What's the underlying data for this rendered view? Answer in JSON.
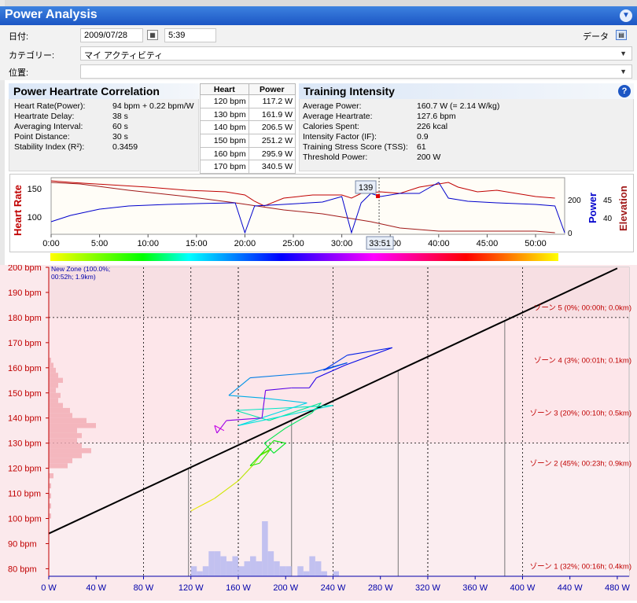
{
  "header": {
    "title": "Power Analysis"
  },
  "form": {
    "date_label": "日付:",
    "date_value": "2009/07/28",
    "time_value": "5:39",
    "data_label": "データ",
    "category_label": "カテゴリー:",
    "category_value": "マイ アクティビティ",
    "location_label": "位置:",
    "location_value": ""
  },
  "correlation": {
    "title": "Power Heartrate Correlation",
    "rows": [
      {
        "label": "Heart Rate(Power):",
        "value": "94 bpm + 0.22 bpm/W"
      },
      {
        "label": "Heartrate Delay:",
        "value": "38 s"
      },
      {
        "label": "Averaging Interval:",
        "value": "60 s"
      },
      {
        "label": "Point Distance:",
        "value": "30 s"
      },
      {
        "label": "Stability Index (R²):",
        "value": "0.3459"
      }
    ]
  },
  "hr_table": {
    "headers": [
      "Heart",
      "Power"
    ],
    "rows": [
      [
        "120 bpm",
        "117.2 W"
      ],
      [
        "130 bpm",
        "161.9 W"
      ],
      [
        "140 bpm",
        "206.5 W"
      ],
      [
        "150 bpm",
        "251.2 W"
      ],
      [
        "160 bpm",
        "295.9 W"
      ],
      [
        "170 bpm",
        "340.5 W"
      ]
    ]
  },
  "intensity": {
    "title": "Training Intensity",
    "rows": [
      {
        "label": "Average Power:",
        "value": "160.7 W (= 2.14 W/kg)"
      },
      {
        "label": "Average Heartrate:",
        "value": "127.6 bpm"
      },
      {
        "label": "Calories Spent:",
        "value": "226 kcal"
      },
      {
        "label": "Intensity Factor (IF):",
        "value": "0.9"
      },
      {
        "label": "Training Stress Score (TSS):",
        "value": "61"
      },
      {
        "label": "Threshold Power:",
        "value": "200 W"
      }
    ]
  },
  "timeline": {
    "left_axis_label": "Heart Rate",
    "right_axis1_label": "Power",
    "right_axis2_label": "Elevation",
    "hr_ticks": [
      "150",
      "100"
    ],
    "power_ticks": [
      "200",
      "0"
    ],
    "elev_ticks": [
      "45",
      "40"
    ],
    "time_ticks": [
      "0:00",
      "5:00",
      "10:00",
      "15:00",
      "20:00",
      "25:00",
      "30:00",
      "35:00",
      "40:00",
      "45:00",
      "50:00"
    ],
    "cursor_hr": "139",
    "cursor_time": "33:51"
  },
  "chart_data": {
    "type": "scatter",
    "title": "",
    "xlabel": "",
    "ylabel": "",
    "xlim": [
      0,
      490
    ],
    "ylim": [
      77,
      200
    ],
    "x_ticks": [
      "0 W",
      "40 W",
      "80 W",
      "120 W",
      "160 W",
      "200 W",
      "240 W",
      "280 W",
      "320 W",
      "360 W",
      "400 W",
      "440 W",
      "480 W"
    ],
    "y_ticks": [
      "200 bpm",
      "190 bpm",
      "180 bpm",
      "170 bpm",
      "160 bpm",
      "150 bpm",
      "140 bpm",
      "130 bpm",
      "120 bpm",
      "110 bpm",
      "100 bpm",
      "90 bpm",
      "80 bpm"
    ],
    "regression": {
      "intercept": 94,
      "slope": 0.22
    },
    "zone_lines_bpm": [
      180,
      130
    ],
    "zone_labels": [
      "ゾーン 5 (0%; 00:00h; 0.0km)",
      "ゾーン 4 (3%; 00:01h; 0.1km)",
      "ゾーン 3 (20%; 00:10h; 0.5km)",
      "ゾーン 2 (45%; 00:23h; 0.9km)",
      "ゾーン 1 (32%; 00:16h; 0.4km)"
    ],
    "zone_box": [
      "New Zone (100.0%;",
      "00:52h; 1.9km)"
    ],
    "trajectory": [
      [
        120,
        103
      ],
      [
        140,
        108
      ],
      [
        160,
        115
      ],
      [
        172,
        121
      ],
      [
        180,
        126
      ],
      [
        186,
        127
      ],
      [
        178,
        125
      ],
      [
        188,
        128
      ],
      [
        178,
        122
      ],
      [
        170,
        121
      ],
      [
        190,
        131
      ],
      [
        200,
        130
      ],
      [
        190,
        126
      ],
      [
        182,
        130
      ],
      [
        200,
        136
      ],
      [
        222,
        142
      ],
      [
        230,
        146
      ],
      [
        186,
        139
      ],
      [
        158,
        143
      ],
      [
        240,
        145
      ],
      [
        160,
        137
      ],
      [
        218,
        146
      ],
      [
        180,
        148
      ],
      [
        152,
        149
      ],
      [
        170,
        156
      ],
      [
        222,
        158
      ],
      [
        252,
        162
      ],
      [
        232,
        159
      ],
      [
        252,
        165
      ],
      [
        290,
        168
      ],
      [
        250,
        161
      ],
      [
        226,
        156
      ],
      [
        220,
        152
      ],
      [
        205,
        152
      ],
      [
        183,
        151
      ],
      [
        180,
        140
      ],
      [
        150,
        139
      ],
      [
        142,
        134
      ],
      [
        140,
        137
      ],
      [
        148,
        135
      ]
    ],
    "hr_histogram": [
      {
        "bpm": 100,
        "count": 1
      },
      {
        "bpm": 104,
        "count": 1
      },
      {
        "bpm": 108,
        "count": 1
      },
      {
        "bpm": 112,
        "count": 1
      },
      {
        "bpm": 116,
        "count": 2
      },
      {
        "bpm": 120,
        "count": 8
      },
      {
        "bpm": 122,
        "count": 10
      },
      {
        "bpm": 124,
        "count": 14
      },
      {
        "bpm": 126,
        "count": 18
      },
      {
        "bpm": 128,
        "count": 14
      },
      {
        "bpm": 130,
        "count": 12
      },
      {
        "bpm": 132,
        "count": 14
      },
      {
        "bpm": 134,
        "count": 12
      },
      {
        "bpm": 136,
        "count": 20
      },
      {
        "bpm": 138,
        "count": 16
      },
      {
        "bpm": 140,
        "count": 10
      },
      {
        "bpm": 142,
        "count": 9
      },
      {
        "bpm": 144,
        "count": 6
      },
      {
        "bpm": 146,
        "count": 4
      },
      {
        "bpm": 148,
        "count": 5
      },
      {
        "bpm": 150,
        "count": 3
      },
      {
        "bpm": 152,
        "count": 4
      },
      {
        "bpm": 154,
        "count": 6
      },
      {
        "bpm": 156,
        "count": 4
      },
      {
        "bpm": 158,
        "count": 3
      },
      {
        "bpm": 160,
        "count": 2
      },
      {
        "bpm": 162,
        "count": 1
      }
    ],
    "power_histogram": [
      {
        "w": 120,
        "count": 2
      },
      {
        "w": 125,
        "count": 1
      },
      {
        "w": 130,
        "count": 2
      },
      {
        "w": 135,
        "count": 5
      },
      {
        "w": 140,
        "count": 5
      },
      {
        "w": 145,
        "count": 4
      },
      {
        "w": 150,
        "count": 3
      },
      {
        "w": 155,
        "count": 4
      },
      {
        "w": 160,
        "count": 2
      },
      {
        "w": 165,
        "count": 3
      },
      {
        "w": 170,
        "count": 4
      },
      {
        "w": 175,
        "count": 3
      },
      {
        "w": 180,
        "count": 11
      },
      {
        "w": 185,
        "count": 5
      },
      {
        "w": 190,
        "count": 3
      },
      {
        "w": 195,
        "count": 2
      },
      {
        "w": 200,
        "count": 2
      },
      {
        "w": 210,
        "count": 2
      },
      {
        "w": 215,
        "count": 1
      },
      {
        "w": 220,
        "count": 4
      },
      {
        "w": 225,
        "count": 3
      },
      {
        "w": 230,
        "count": 1
      },
      {
        "w": 240,
        "count": 1
      }
    ],
    "zone_drop_lines_w": [
      118,
      205,
      295,
      385
    ]
  },
  "colors": {
    "title_bar": "#1c56c4",
    "hr_line": "#c00000",
    "power_line": "#0000cc",
    "elev_line": "#a01818",
    "zone_grid": "#000000",
    "hist_fill": "#f3b0b8",
    "hist_power": "#b7b9f0"
  }
}
